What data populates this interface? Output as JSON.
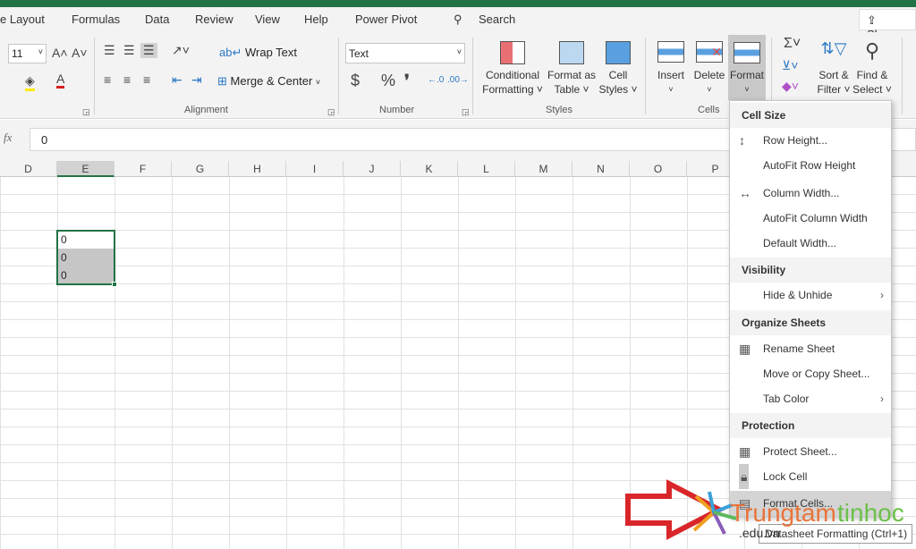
{
  "tabs": [
    "e Layout",
    "Formulas",
    "Data",
    "Review",
    "View",
    "Help",
    "Power Pivot"
  ],
  "search": "Search",
  "share": "Share",
  "font_size": "11",
  "alignment": {
    "wrap_text": "Wrap Text",
    "merge_center": "Merge & Center",
    "group": "Alignment"
  },
  "number": {
    "format": "Text",
    "currency": "$",
    "percent": "%",
    "comma": "❜",
    "group": "Number"
  },
  "styles": {
    "conditional": [
      "Conditional",
      "Formatting ˅"
    ],
    "format_table": [
      "Format as",
      "Table ˅"
    ],
    "cell_styles": [
      "Cell",
      "Styles ˅"
    ],
    "group": "Styles"
  },
  "cells": {
    "insert": "Insert",
    "delete": "Delete",
    "format": "Format",
    "group": "Cells"
  },
  "editing": {
    "sort": [
      "Sort &",
      "Filter ˅"
    ],
    "find": [
      "Find &",
      "Select ˅"
    ]
  },
  "formula_bar": {
    "fx": "fx",
    "value": "0"
  },
  "columns": [
    "D",
    "E",
    "F",
    "G",
    "H",
    "I",
    "J",
    "K",
    "L",
    "M",
    "N",
    "O",
    "P"
  ],
  "selected_column": "E",
  "cells_values": [
    "0",
    "0",
    "0"
  ],
  "menu": {
    "cell_size": "Cell Size",
    "row_height": "Row Height...",
    "autofit_row": "AutoFit Row Height",
    "column_width": "Column Width...",
    "autofit_column": "AutoFit Column Width",
    "default_width": "Default Width...",
    "visibility": "Visibility",
    "hide_unhide": "Hide & Unhide",
    "organize": "Organize Sheets",
    "rename": "Rename Sheet",
    "move_copy": "Move or Copy Sheet...",
    "tab_color": "Tab Color",
    "protection": "Protection",
    "protect_sheet": "Protect Sheet...",
    "lock_cell": "Lock Cell",
    "format_cells": "Format Cells..."
  },
  "tooltip": "Datasheet Formatting (Ctrl+1)",
  "watermark": {
    "text1": "Trungtam",
    "text2": "tinhoc",
    "suffix": ".edu.vn"
  },
  "colors": {
    "excel_green": "#217346",
    "arrow_red": "#d9262a"
  }
}
